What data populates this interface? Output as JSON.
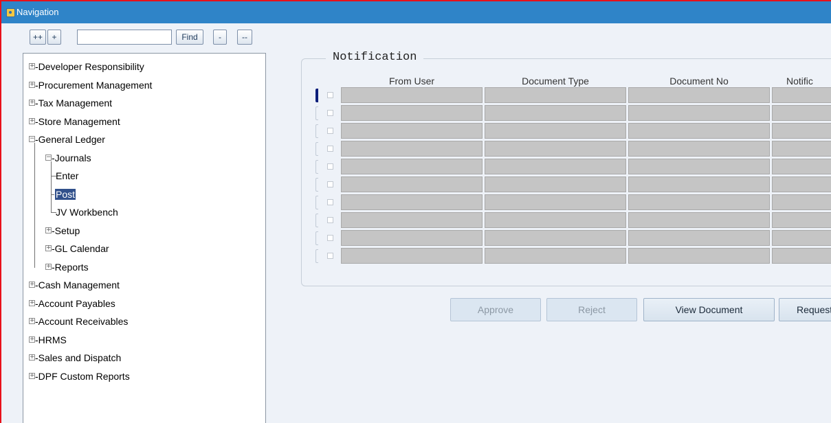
{
  "window": {
    "title": "Navigation"
  },
  "toolbar": {
    "expand_all_label": "++",
    "expand_label": "+",
    "search_value": "",
    "find_label": "Find",
    "collapse_label": "-",
    "collapse_all_label": "--"
  },
  "tree": [
    {
      "label": "Developer Responsibility",
      "state": "collapsed"
    },
    {
      "label": "Procurement Management",
      "state": "collapsed"
    },
    {
      "label": "Tax Management",
      "state": "collapsed"
    },
    {
      "label": "Store Management",
      "state": "collapsed"
    },
    {
      "label": "General Ledger",
      "state": "expanded"
    },
    {
      "label": "Journals",
      "state": "expanded"
    },
    {
      "label": "Enter",
      "state": "leaf"
    },
    {
      "label": "Post",
      "state": "leaf",
      "selected": true
    },
    {
      "label": "JV Workbench",
      "state": "leaf"
    },
    {
      "label": "Setup",
      "state": "collapsed"
    },
    {
      "label": "GL Calendar",
      "state": "collapsed"
    },
    {
      "label": "Reports",
      "state": "collapsed"
    },
    {
      "label": "Cash Management",
      "state": "collapsed"
    },
    {
      "label": "Account Payables",
      "state": "collapsed"
    },
    {
      "label": "Account Receivables",
      "state": "collapsed"
    },
    {
      "label": "HRMS",
      "state": "collapsed"
    },
    {
      "label": "Sales and Dispatch",
      "state": "collapsed"
    },
    {
      "label": "DPF Custom Reports",
      "state": "collapsed"
    }
  ],
  "notification": {
    "title": "Notification",
    "columns": [
      "From User",
      "Document Type",
      "Document No",
      "Notific"
    ],
    "row_count": 10
  },
  "actions": {
    "approve": "Approve",
    "reject": "Reject",
    "view_document": "View Document",
    "request": "Request I"
  },
  "colors": {
    "titlebar": "#2f84c8",
    "frame_border": "#e8101a",
    "selected_node": "#31508b",
    "grid_cell": "#c5c5c5"
  }
}
